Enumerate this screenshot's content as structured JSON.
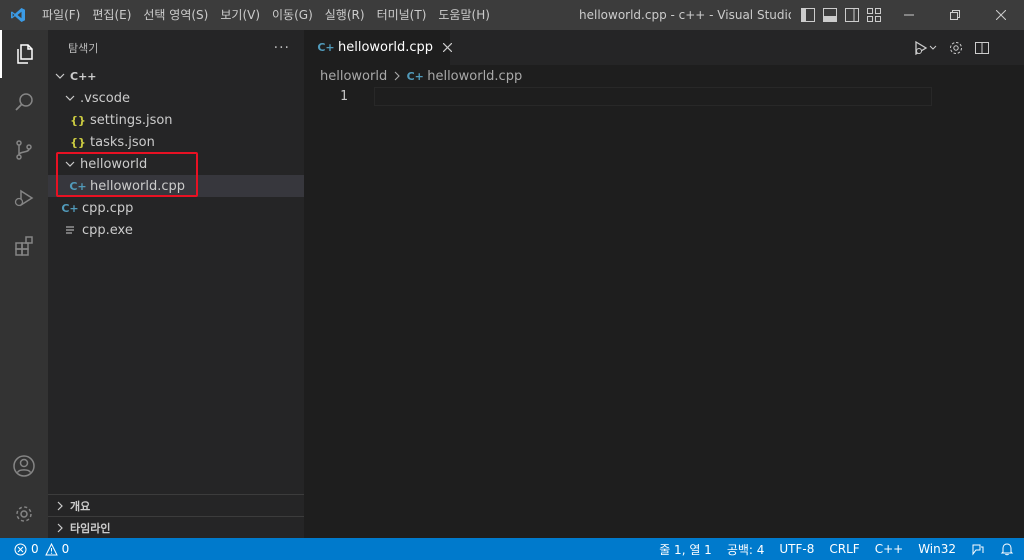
{
  "titlebar": {
    "menu": [
      "파일(F)",
      "편집(E)",
      "선택 영역(S)",
      "보기(V)",
      "이동(G)",
      "실행(R)",
      "터미널(T)",
      "도움말(H)"
    ],
    "title": "helloworld.cpp - c++ - Visual Studio C..."
  },
  "sidebar": {
    "title": "탐색기",
    "more": "···",
    "root": "C++",
    "tree": [
      {
        "label": ".vscode"
      },
      {
        "label": "settings.json"
      },
      {
        "label": "tasks.json"
      },
      {
        "label": "helloworld"
      },
      {
        "label": "helloworld.cpp"
      },
      {
        "label": "cpp.cpp"
      },
      {
        "label": "cpp.exe"
      }
    ],
    "outline": "개요",
    "timeline": "타임라인"
  },
  "editor": {
    "tab_label": "helloworld.cpp",
    "breadcrumb": [
      "helloworld",
      "helloworld.cpp"
    ],
    "line_number": "1"
  },
  "statusbar": {
    "errors": "0",
    "warnings": "0",
    "position": "줄 1, 열 1",
    "spaces": "공백: 4",
    "encoding": "UTF-8",
    "eol": "CRLF",
    "language": "C++",
    "platform": "Win32"
  },
  "colors": {
    "accent": "#007acc",
    "cpp_icon": "#519aba",
    "json_icon": "#cbcb41",
    "highlight": "#e81123"
  }
}
